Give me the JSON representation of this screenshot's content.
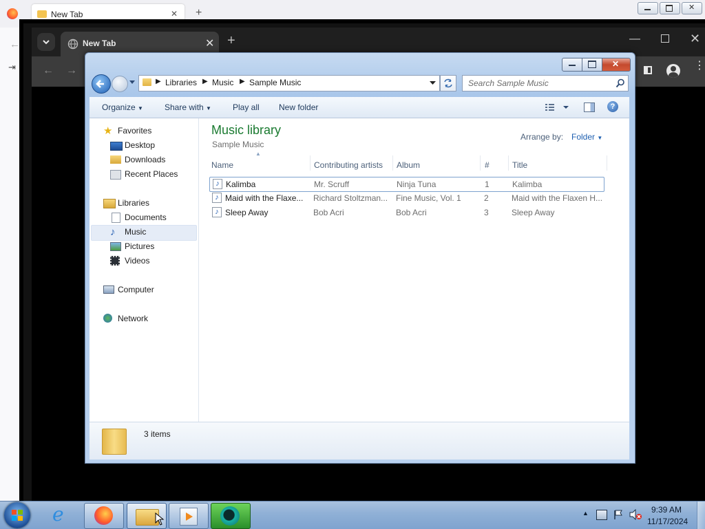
{
  "firefox": {
    "tab_title": "New Tab"
  },
  "chrome": {
    "tab_title": "New Tab",
    "close_glyph": "✕",
    "new_tab_glyph": "+",
    "minimize_glyph": "—",
    "close_window_glyph": "✕"
  },
  "explorer": {
    "breadcrumb": [
      "Libraries",
      "Music",
      "Sample Music"
    ],
    "search_placeholder": "Search Sample Music",
    "commands": {
      "organize": "Organize",
      "share_with": "Share with",
      "play_all": "Play all",
      "new_folder": "New folder"
    },
    "library_title": "Music library",
    "library_subtitle": "Sample Music",
    "arrange_label": "Arrange by:",
    "arrange_value": "Folder",
    "nav": {
      "favorites": "Favorites",
      "desktop": "Desktop",
      "downloads": "Downloads",
      "recent_places": "Recent Places",
      "libraries": "Libraries",
      "documents": "Documents",
      "music": "Music",
      "pictures": "Pictures",
      "videos": "Videos",
      "computer": "Computer",
      "network": "Network"
    },
    "columns": {
      "name": "Name",
      "artists": "Contributing artists",
      "album": "Album",
      "number": "#",
      "title": "Title"
    },
    "files": [
      {
        "name": "Kalimba",
        "artists": "Mr. Scruff",
        "album": "Ninja Tuna",
        "number": "1",
        "title": "Kalimba"
      },
      {
        "name": "Maid with the Flaxe...",
        "artists": "Richard Stoltzman...",
        "album": "Fine Music, Vol. 1",
        "number": "2",
        "title": "Maid with the Flaxen H..."
      },
      {
        "name": "Sleep Away",
        "artists": "Bob Acri",
        "album": "Bob Acri",
        "number": "3",
        "title": "Sleep Away"
      }
    ],
    "status_count": "3 items"
  },
  "taskbar": {
    "time": "9:39 AM",
    "date": "11/17/2024"
  },
  "colors": {
    "accent_green": "#1a7a30",
    "link_blue": "#1e5fb0",
    "taskbar": "#8fb0d6",
    "chrome_dark": "#3c3c3c"
  }
}
